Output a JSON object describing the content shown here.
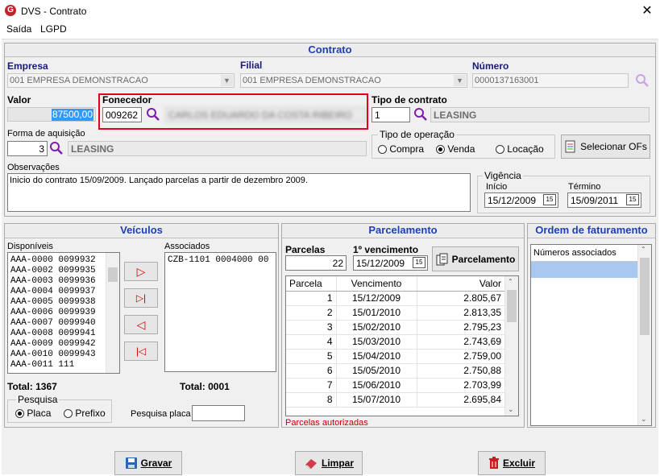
{
  "window": {
    "title": "DVS - Contrato",
    "icon": "app-logo-icon"
  },
  "menu": {
    "items": [
      "Saída",
      "LGPD"
    ]
  },
  "contrato": {
    "header": "Contrato",
    "empresa_label": "Empresa",
    "empresa_value": "001 EMPRESA DEMONSTRACAO",
    "filial_label": "Filial",
    "filial_value": "001 EMPRESA DEMONSTRACAO",
    "numero_label": "Número",
    "numero_value": "0000137163001",
    "valor_label": "Valor",
    "valor_value": "87500,00",
    "fornecedor_label": "Fonecedor",
    "fornecedor_code": "009262",
    "fornecedor_name": "CARLOS EDUARDO DA COSTA RIBEIRO",
    "tipo_contrato_label": "Tipo de contrato",
    "tipo_contrato_code": "1",
    "tipo_contrato_name": "LEASING",
    "forma_label": "Forma de aquisição",
    "forma_code": "3",
    "forma_name": "LEASING",
    "tipo_operacao_label": "Tipo de operação",
    "operacao_options": [
      "Compra",
      "Venda",
      "Locação"
    ],
    "operacao_selected": "Venda",
    "selecionar_ofs_label": "Selecionar OFs",
    "observacoes_label": "Observações",
    "observacoes_value": "Inicio do contrato 15/09/2009. Lançado parcelas a partir de dezembro 2009.",
    "vigencia_label": "Vigência",
    "inicio_label": "Início",
    "inicio_value": "15/12/2009",
    "termino_label": "Término",
    "termino_value": "15/09/2011"
  },
  "veiculos": {
    "header": "Veículos",
    "disponiveis_label": "Disponíveis",
    "associados_label": "Associados",
    "disponiveis": [
      "AAA-0000 0099932",
      "AAA-0002 0099935",
      "AAA-0003 0099936",
      "AAA-0004 0099937",
      "AAA-0005 0099938",
      "AAA-0006 0099939",
      "AAA-0007 0099940",
      "AAA-0008 0099941",
      "AAA-0009 0099942",
      "AAA-0010 0099943",
      "AAA-0011 111"
    ],
    "associados": [
      "CZB-1101 0004000 00"
    ],
    "total_disp": "Total: 1367",
    "total_assoc": "Total: 0001",
    "pesquisa_label": "Pesquisa",
    "pesquisa_options": [
      "Placa",
      "Prefixo"
    ],
    "pesquisa_selected": "Placa",
    "pesquisa_placa_label": "Pesquisa placa",
    "pesquisa_placa_value": ""
  },
  "parcelamento": {
    "header": "Parcelamento",
    "parcelas_label": "Parcelas",
    "parcelas_value": "22",
    "vencimento_label": "1º vencimento",
    "vencimento_value": "15/12/2009",
    "button_label": "Parcelamento",
    "columns": [
      "Parcela",
      "Vencimento",
      "Valor"
    ],
    "rows": [
      [
        "1",
        "15/12/2009",
        "2.805,67"
      ],
      [
        "2",
        "15/01/2010",
        "2.813,35"
      ],
      [
        "3",
        "15/02/2010",
        "2.795,23"
      ],
      [
        "4",
        "15/03/2010",
        "2.743,69"
      ],
      [
        "5",
        "15/04/2010",
        "2.759,00"
      ],
      [
        "6",
        "15/05/2010",
        "2.750,88"
      ],
      [
        "7",
        "15/06/2010",
        "2.703,99"
      ],
      [
        "8",
        "15/07/2010",
        "2.695,84"
      ]
    ],
    "status": "Parcelas autorizadas",
    "status_color": "#c00000"
  },
  "ordem": {
    "header": "Ordem de faturamento",
    "column": "Números associados"
  },
  "buttons": {
    "gravar": "Gravar",
    "limpar": "Limpar",
    "excluir": "Excluir"
  },
  "colors": {
    "header_text": "#1f3fb3",
    "highlight_box": "#e0001a",
    "selection": "#3399ff"
  }
}
